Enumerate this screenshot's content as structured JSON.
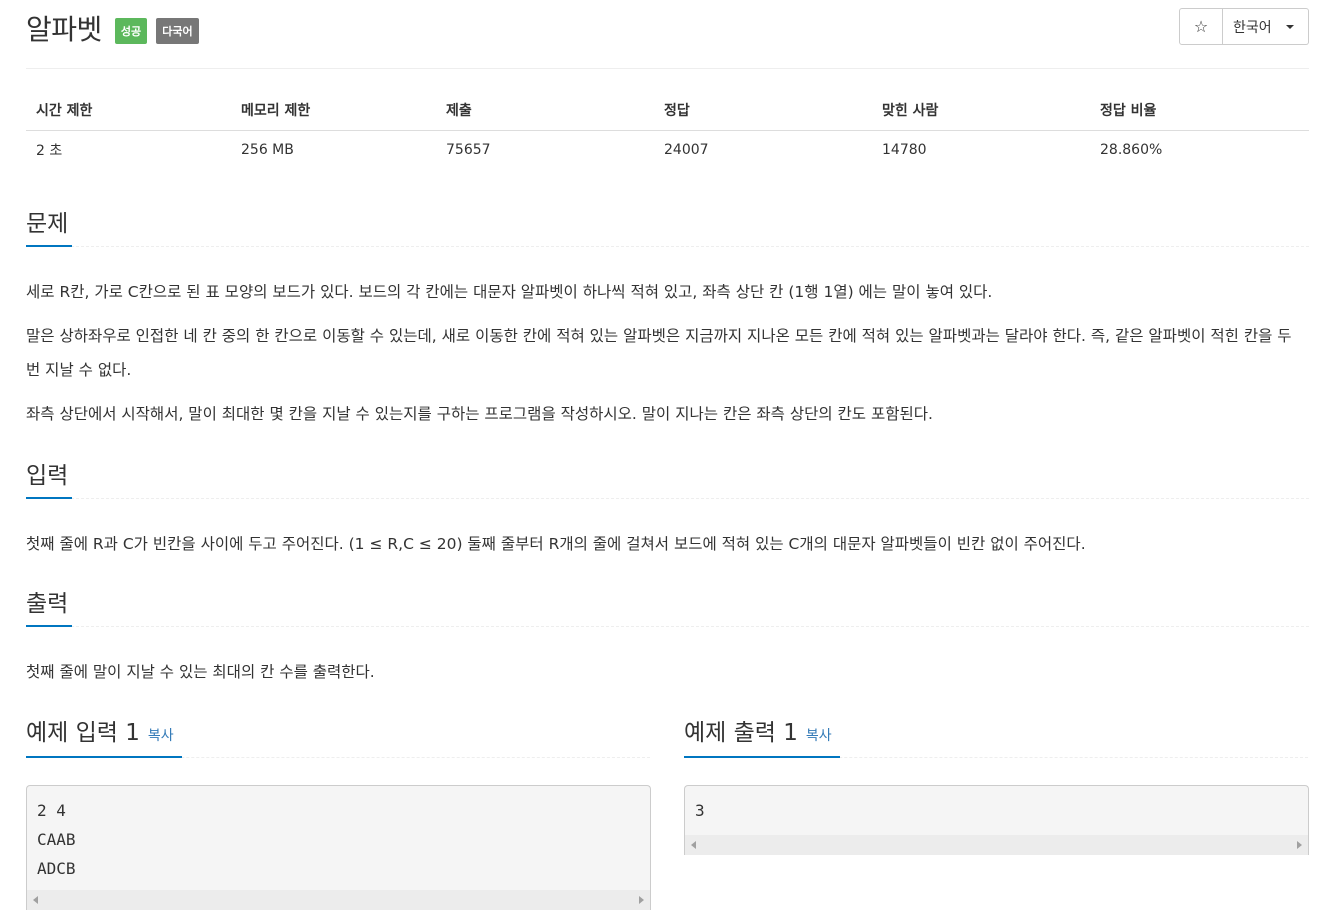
{
  "header": {
    "title": "알파벳",
    "badge_success": "성공",
    "badge_multilang": "다국어",
    "star_glyph": "☆",
    "language": "한국어"
  },
  "stats": {
    "headers": [
      "시간 제한",
      "메모리 제한",
      "제출",
      "정답",
      "맞힌 사람",
      "정답 비율"
    ],
    "values": [
      "2 초",
      "256 MB",
      "75657",
      "24007",
      "14780",
      "28.860%"
    ]
  },
  "problem": {
    "heading": "문제",
    "paragraphs": [
      "세로 R칸, 가로 C칸으로 된 표 모양의 보드가 있다. 보드의 각 칸에는 대문자 알파벳이 하나씩 적혀 있고, 좌측 상단 칸 (1행 1열) 에는 말이 놓여 있다.",
      "말은 상하좌우로 인접한 네 칸 중의 한 칸으로 이동할 수 있는데, 새로 이동한 칸에 적혀 있는 알파벳은 지금까지 지나온 모든 칸에 적혀 있는 알파벳과는 달라야 한다. 즉, 같은 알파벳이 적힌 칸을 두 번 지날 수 없다.",
      "좌측 상단에서 시작해서, 말이 최대한 몇 칸을 지날 수 있는지를 구하는 프로그램을 작성하시오. 말이 지나는 칸은 좌측 상단의 칸도 포함된다."
    ]
  },
  "input": {
    "heading": "입력",
    "text": "첫째 줄에 R과 C가 빈칸을 사이에 두고 주어진다. (1 ≤ R,C ≤ 20) 둘째 줄부터 R개의 줄에 걸쳐서 보드에 적혀 있는 C개의 대문자 알파벳들이 빈칸 없이 주어진다."
  },
  "output": {
    "heading": "출력",
    "text": "첫째 줄에 말이 지날 수 있는 최대의 칸 수를 출력한다."
  },
  "samples": {
    "input_heading": "예제 입력 1",
    "output_heading": "예제 출력 1",
    "copy_label": "복사",
    "input_data": "2 4\nCAAB\nADCB",
    "output_data": "3"
  },
  "colors": {
    "accent": "#0076c0",
    "success": "#5cb85c",
    "default_badge": "#777777",
    "link": "#337ab7"
  }
}
